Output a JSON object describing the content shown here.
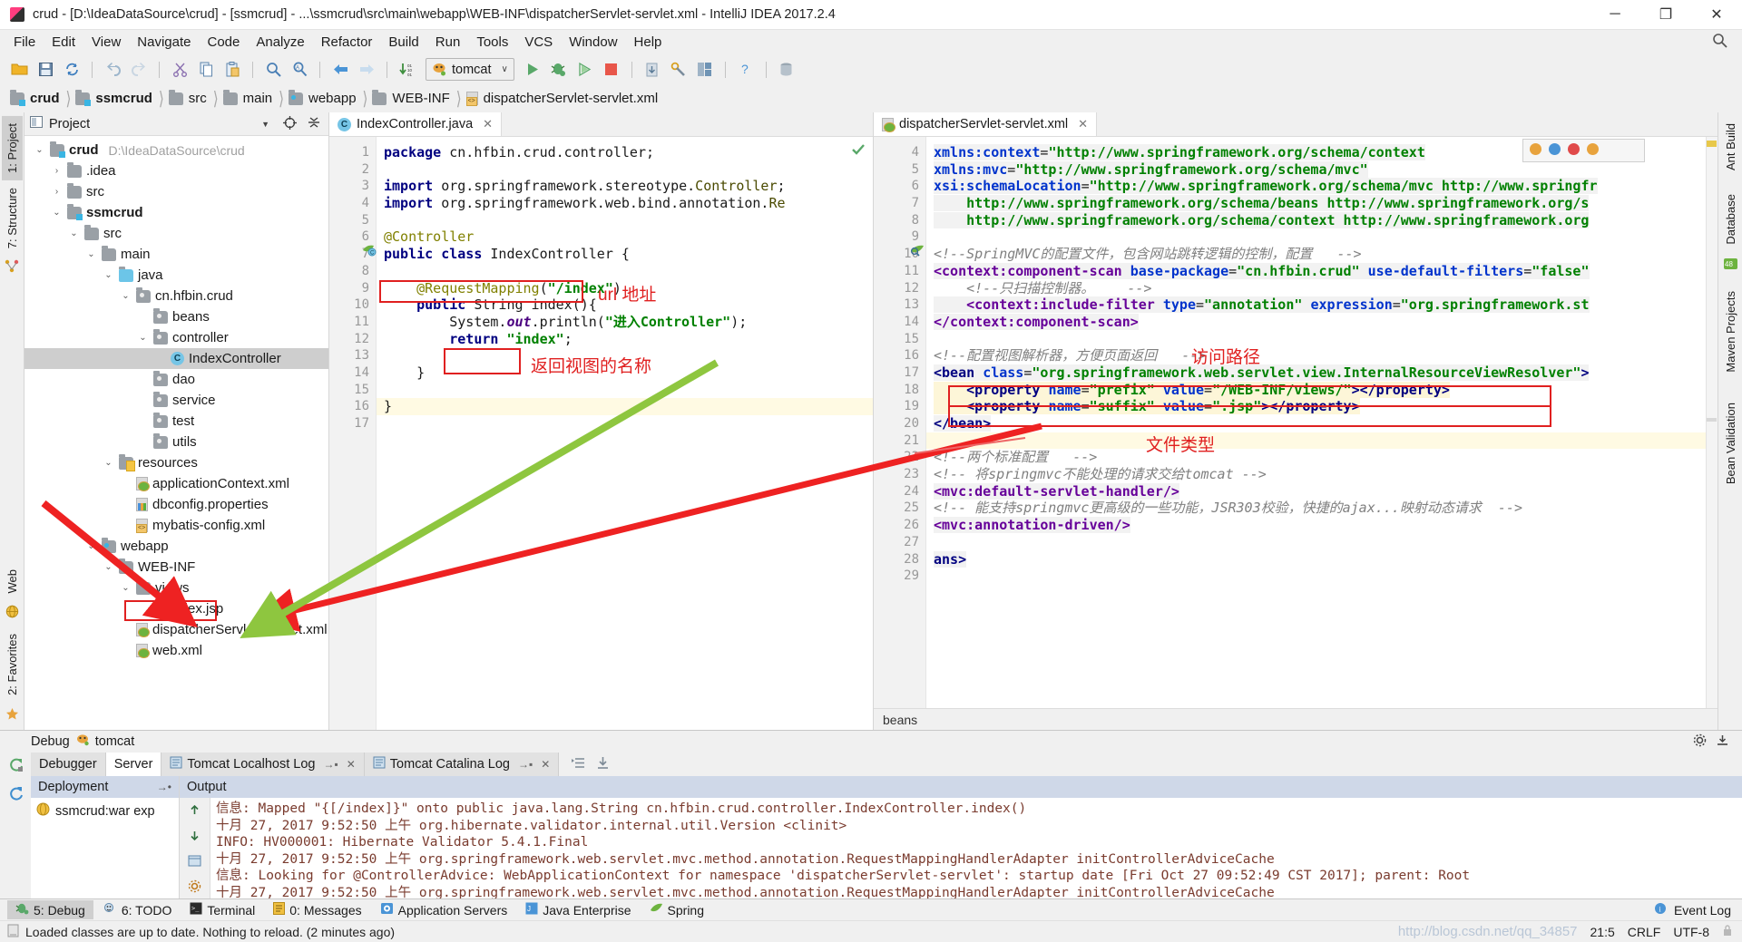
{
  "window": {
    "title": "crud - [D:\\IdeaDataSource\\crud] - [ssmcrud] - ...\\ssmcrud\\src\\main\\webapp\\WEB-INF\\dispatcherServlet-servlet.xml - IntelliJ IDEA 2017.2.4",
    "minimize": "─",
    "maximize": "❐",
    "close": "✕"
  },
  "menu": [
    "File",
    "Edit",
    "View",
    "Navigate",
    "Code",
    "Analyze",
    "Refactor",
    "Build",
    "Run",
    "Tools",
    "VCS",
    "Window",
    "Help"
  ],
  "toolbar": {
    "run_config": "tomcat",
    "caret": "∨"
  },
  "breadcrumb": [
    {
      "label": "crud",
      "icon": "module-folder-icon",
      "bold": true
    },
    {
      "label": "ssmcrud",
      "icon": "module-folder-icon",
      "bold": true
    },
    {
      "label": "src",
      "icon": "folder-icon",
      "bold": false
    },
    {
      "label": "main",
      "icon": "folder-icon",
      "bold": false
    },
    {
      "label": "webapp",
      "icon": "web-folder-icon",
      "bold": false
    },
    {
      "label": "WEB-INF",
      "icon": "folder-icon",
      "bold": false
    },
    {
      "label": "dispatcherServlet-servlet.xml",
      "icon": "xml-file-icon",
      "bold": false
    }
  ],
  "left_tool_strip": [
    "1: Project",
    "7: Structure"
  ],
  "right_tool_strip": [
    "Ant Build",
    "Database",
    "Maven Projects",
    "Bean Validation"
  ],
  "project_panel": {
    "title": "Project",
    "tree": [
      {
        "depth": 0,
        "arrow": "⌄",
        "label": "crud",
        "path": "D:\\IdeaDataSource\\crud",
        "icon": "module-folder-icon",
        "bold": true,
        "selected": false
      },
      {
        "depth": 1,
        "arrow": "›",
        "label": ".idea",
        "icon": "folder-icon",
        "bold": false,
        "selected": false
      },
      {
        "depth": 1,
        "arrow": "›",
        "label": "src",
        "icon": "folder-icon",
        "bold": false,
        "selected": false
      },
      {
        "depth": 1,
        "arrow": "⌄",
        "label": "ssmcrud",
        "icon": "module-folder-icon",
        "bold": true,
        "selected": false
      },
      {
        "depth": 2,
        "arrow": "⌄",
        "label": "src",
        "icon": "folder-icon",
        "bold": false,
        "selected": false
      },
      {
        "depth": 3,
        "arrow": "⌄",
        "label": "main",
        "icon": "folder-icon",
        "bold": false,
        "selected": false
      },
      {
        "depth": 4,
        "arrow": "⌄",
        "label": "java",
        "icon": "source-folder-icon",
        "bold": false,
        "selected": false
      },
      {
        "depth": 5,
        "arrow": "⌄",
        "label": "cn.hfbin.crud",
        "icon": "package-icon",
        "bold": false,
        "selected": false
      },
      {
        "depth": 6,
        "arrow": "",
        "label": "beans",
        "icon": "package-icon",
        "bold": false,
        "selected": false
      },
      {
        "depth": 6,
        "arrow": "⌄",
        "label": "controller",
        "icon": "package-icon",
        "bold": false,
        "selected": false
      },
      {
        "depth": 7,
        "arrow": "",
        "label": "IndexController",
        "icon": "java-class-icon",
        "bold": false,
        "selected": true
      },
      {
        "depth": 6,
        "arrow": "",
        "label": "dao",
        "icon": "package-icon",
        "bold": false,
        "selected": false
      },
      {
        "depth": 6,
        "arrow": "",
        "label": "service",
        "icon": "package-icon",
        "bold": false,
        "selected": false
      },
      {
        "depth": 6,
        "arrow": "",
        "label": "test",
        "icon": "package-icon",
        "bold": false,
        "selected": false
      },
      {
        "depth": 6,
        "arrow": "",
        "label": "utils",
        "icon": "package-icon",
        "bold": false,
        "selected": false
      },
      {
        "depth": 4,
        "arrow": "⌄",
        "label": "resources",
        "icon": "resources-folder-icon",
        "bold": false,
        "selected": false
      },
      {
        "depth": 5,
        "arrow": "",
        "label": "applicationContext.xml",
        "icon": "spring-xml-icon",
        "bold": false,
        "selected": false
      },
      {
        "depth": 5,
        "arrow": "",
        "label": "dbconfig.properties",
        "icon": "properties-file-icon",
        "bold": false,
        "selected": false
      },
      {
        "depth": 5,
        "arrow": "",
        "label": "mybatis-config.xml",
        "icon": "xml-file-icon",
        "bold": false,
        "selected": false
      },
      {
        "depth": 3,
        "arrow": "⌄",
        "label": "webapp",
        "icon": "web-folder-icon",
        "bold": false,
        "selected": false
      },
      {
        "depth": 4,
        "arrow": "⌄",
        "label": "WEB-INF",
        "icon": "folder-icon",
        "bold": false,
        "selected": false
      },
      {
        "depth": 5,
        "arrow": "⌄",
        "label": "views",
        "icon": "folder-icon",
        "bold": false,
        "selected": false
      },
      {
        "depth": 6,
        "arrow": "",
        "label": "index.jsp",
        "icon": "jsp-file-icon",
        "bold": false,
        "selected": false
      },
      {
        "depth": 5,
        "arrow": "",
        "label": "dispatcherServlet-servlet.xml",
        "icon": "spring-xml-icon",
        "bold": false,
        "selected": false
      },
      {
        "depth": 5,
        "arrow": "",
        "label": "web.xml",
        "icon": "web-xml-icon",
        "bold": false,
        "selected": false
      }
    ]
  },
  "editor_java": {
    "tab": "IndexController.java",
    "tab_close": "✕",
    "lines": [
      {
        "n": 1,
        "html": "<span class=\"kw\">package</span> cn.hfbin.crud.controller;"
      },
      {
        "n": 2,
        "html": ""
      },
      {
        "n": 3,
        "html": "<span class=\"kw\">import</span> org.springframework.stereotype.<span class=\"cls\">Controller</span>;"
      },
      {
        "n": 4,
        "html": "<span class=\"kw\">import</span> org.springframework.web.bind.annotation.<span class=\"cls\">Re</span>"
      },
      {
        "n": 5,
        "html": ""
      },
      {
        "n": 6,
        "html": "<span class=\"ann\">@Controller</span>"
      },
      {
        "n": 7,
        "html": "<span class=\"kw\">public class</span> IndexController {"
      },
      {
        "n": 8,
        "html": ""
      },
      {
        "n": 9,
        "html": "    <span class=\"ann\">@RequestMapping</span>(<span class=\"str\">\"/index\"</span>)"
      },
      {
        "n": 10,
        "html": "    <span class=\"kw\">public</span> String index(){"
      },
      {
        "n": 11,
        "html": "        System.<span class=\"fld\">out</span>.println(<span class=\"str\">\"进入Controller\"</span>);"
      },
      {
        "n": 12,
        "html": "        <span class=\"kw\">return</span> <span class=\"str\">\"index\"</span>;"
      },
      {
        "n": 13,
        "html": ""
      },
      {
        "n": 14,
        "html": "    }"
      },
      {
        "n": 15,
        "html": ""
      },
      {
        "n": 16,
        "html": "}",
        "hl": true
      },
      {
        "n": 17,
        "html": ""
      }
    ]
  },
  "editor_xml": {
    "tab": "dispatcherServlet-servlet.xml",
    "tab_close": "✕",
    "status": "beans",
    "lines": [
      {
        "n": 4,
        "html": "<span class=\"xhl\"><span class=\"xattr\">xmlns:context</span>=<span class=\"xval\">\"http://www.springframework.org/schema/context</span></span>"
      },
      {
        "n": 5,
        "html": "<span class=\"xhl\"><span class=\"xattr\">xmlns:mvc</span>=<span class=\"xval\">\"http://www.springframework.org/schema/mvc\"</span></span>"
      },
      {
        "n": 6,
        "html": "<span class=\"xhl\"><span class=\"xattr\">xsi:schemaLocation</span>=<span class=\"xval\">\"http://www.springframework.org/schema/mvc http://www.springfr</span></span>"
      },
      {
        "n": 7,
        "html": "<span class=\"xhl\">    <span class=\"xval\">http://www.springframework.org/schema/beans http://www.springframework.org/s</span></span>"
      },
      {
        "n": 8,
        "html": "<span class=\"xhl\">    <span class=\"xval\">http://www.springframework.org/schema/context http://www.springframework.org</span></span>"
      },
      {
        "n": 9,
        "html": ""
      },
      {
        "n": 10,
        "html": "<span class=\"xcom\">&lt;!--SpringMVC的配置文件，包含网站跳转逻辑的控制，配置   --&gt;</span>"
      },
      {
        "n": 11,
        "html": "<span class=\"xhl\"><span class=\"xns\">&lt;context:component-scan</span> <span class=\"xattr\">base-package</span>=<span class=\"xval\">\"cn.hfbin.crud\"</span> <span class=\"xattr\">use-default-filters</span>=<span class=\"xval\">\"false\"</span></span>"
      },
      {
        "n": 12,
        "html": "    <span class=\"xcom\">&lt;!--只扫描控制器。    --&gt;</span>"
      },
      {
        "n": 13,
        "html": "<span class=\"xhl\">    <span class=\"xns\">&lt;context:include-filter</span> <span class=\"xattr\">type</span>=<span class=\"xval\">\"annotation\"</span> <span class=\"xattr\">expression</span>=<span class=\"xval\">\"org.springframework.st</span></span>"
      },
      {
        "n": 14,
        "html": "<span class=\"xhl\"><span class=\"xns\">&lt;/context:component-scan&gt;</span></span>"
      },
      {
        "n": 15,
        "html": ""
      },
      {
        "n": 16,
        "html": "<span class=\"xcom\">&lt;!--配置视图解析器，方便页面返回   --&gt;</span>"
      },
      {
        "n": 17,
        "html": "<span class=\"xhl\"><span class=\"xtag\">&lt;bean</span> <span class=\"xattr\">class</span>=<span class=\"xval\">\"org.springframework.web.servlet.view.InternalResourceViewResolver\"</span><span class=\"xtag\">&gt;</span></span>"
      },
      {
        "n": 18,
        "html": "<span class=\"xhl2\">    <span class=\"xtag\">&lt;property</span> <span class=\"xattr\">name</span>=<span class=\"xval\">\"prefix\"</span> <span class=\"xattr\">value</span>=<span class=\"xval\">\"/WEB-INF/views/\"</span><span class=\"xtag\">&gt;&lt;/property&gt;</span></span>"
      },
      {
        "n": 19,
        "html": "<span class=\"xhl2\">    <span class=\"xtag\">&lt;property</span> <span class=\"xattr\">name</span>=<span class=\"xval\">\"suffix\"</span> <span class=\"xattr\">value</span>=<span class=\"xval\">\".jsp\"</span><span class=\"xtag\">&gt;&lt;/property&gt;</span></span>"
      },
      {
        "n": 20,
        "html": "<span class=\"xhl\"><span class=\"xtag\">&lt;/bean&gt;</span></span>"
      },
      {
        "n": 21,
        "html": "",
        "hl": true
      },
      {
        "n": 22,
        "html": "<span class=\"xcom\">&lt;!--两个标准配置   --&gt;</span>"
      },
      {
        "n": 23,
        "html": "<span class=\"xcom\">&lt;!-- 将springmvc不能处理的请求交给tomcat --&gt;</span>"
      },
      {
        "n": 24,
        "html": "<span class=\"xhl\"><span class=\"xns\">&lt;mvc:default-servlet-handler/&gt;</span></span>"
      },
      {
        "n": 25,
        "html": "<span class=\"xcom\">&lt;!-- 能支持springmvc更高级的一些功能，JSR303校验，快捷的ajax...映射动态请求  --&gt;</span>"
      },
      {
        "n": 26,
        "html": "<span class=\"xhl\"><span class=\"xns\">&lt;mvc:annotation-driven/&gt;</span></span>"
      },
      {
        "n": 27,
        "html": ""
      },
      {
        "n": 28,
        "html": "<span class=\"xhl\"><span class=\"xtag\">ans&gt;</span></span>"
      },
      {
        "n": 29,
        "html": ""
      }
    ]
  },
  "annotations": [
    {
      "text": "url 地址",
      "name": "annotation-url-address"
    },
    {
      "text": "返回视图的名称",
      "name": "annotation-return-view-name"
    },
    {
      "text": "访问路径",
      "name": "annotation-access-path"
    },
    {
      "text": "文件类型",
      "name": "annotation-file-type"
    }
  ],
  "debug_panel": {
    "title": "Debug",
    "config_name": "tomcat",
    "tabs": [
      {
        "label": "Debugger",
        "selected": false,
        "closeable": false
      },
      {
        "label": "Server",
        "selected": true,
        "closeable": false
      },
      {
        "label": "Tomcat Localhost Log",
        "selected": false,
        "closeable": true
      },
      {
        "label": "Tomcat Catalina Log",
        "selected": false,
        "closeable": true
      }
    ],
    "tab_close": "✕",
    "deployment_header": "Deployment",
    "output_header": "Output",
    "deployment_items": [
      "ssmcrud:war exp"
    ],
    "console_lines": [
      "信息: Mapped \"{[/index]}\" onto public java.lang.String cn.hfbin.crud.controller.IndexController.index()",
      "十月 27, 2017 9:52:50 上午 org.hibernate.validator.internal.util.Version <clinit>",
      "INFO: HV000001: Hibernate Validator 5.4.1.Final",
      "十月 27, 2017 9:52:50 上午 org.springframework.web.servlet.mvc.method.annotation.RequestMappingHandlerAdapter initControllerAdviceCache",
      "信息: Looking for @ControllerAdvice: WebApplicationContext for namespace 'dispatcherServlet-servlet': startup date [Fri Oct 27 09:52:49 CST 2017]; parent: Root",
      "十月 27, 2017 9:52:50 上午 org.springframework.web.servlet.mvc.method.annotation.RequestMappingHandlerAdapter initControllerAdviceCache"
    ]
  },
  "bottom_toolwindows": [
    {
      "label": "5: Debug",
      "selected": true,
      "icon": "bug-icon"
    },
    {
      "label": "6: TODO",
      "selected": false,
      "icon": "todo-icon"
    },
    {
      "label": "Terminal",
      "selected": false,
      "icon": "terminal-icon"
    },
    {
      "label": "0: Messages",
      "selected": false,
      "icon": "messages-icon"
    },
    {
      "label": "Application Servers",
      "selected": false,
      "icon": "server-icon"
    },
    {
      "label": "Java Enterprise",
      "selected": false,
      "icon": "java-ee-icon"
    },
    {
      "label": "Spring",
      "selected": false,
      "icon": "spring-leaf-icon"
    }
  ],
  "bottom_right_toolwindow": {
    "label": "Event Log",
    "icon": "event-log-icon"
  },
  "left_bottom_toolwindows": [
    {
      "label": "Web",
      "icon": "web-icon"
    },
    {
      "label": "2: Favorites",
      "icon": "favorites-icon"
    }
  ],
  "statusbar": {
    "message": "Loaded classes are up to date. Nothing to reload. (2 minutes ago)",
    "caret": "21:5",
    "line_sep": "CRLF",
    "encoding": "UTF-8",
    "watermark": "http://blog.csdn.net/qq_34857"
  }
}
